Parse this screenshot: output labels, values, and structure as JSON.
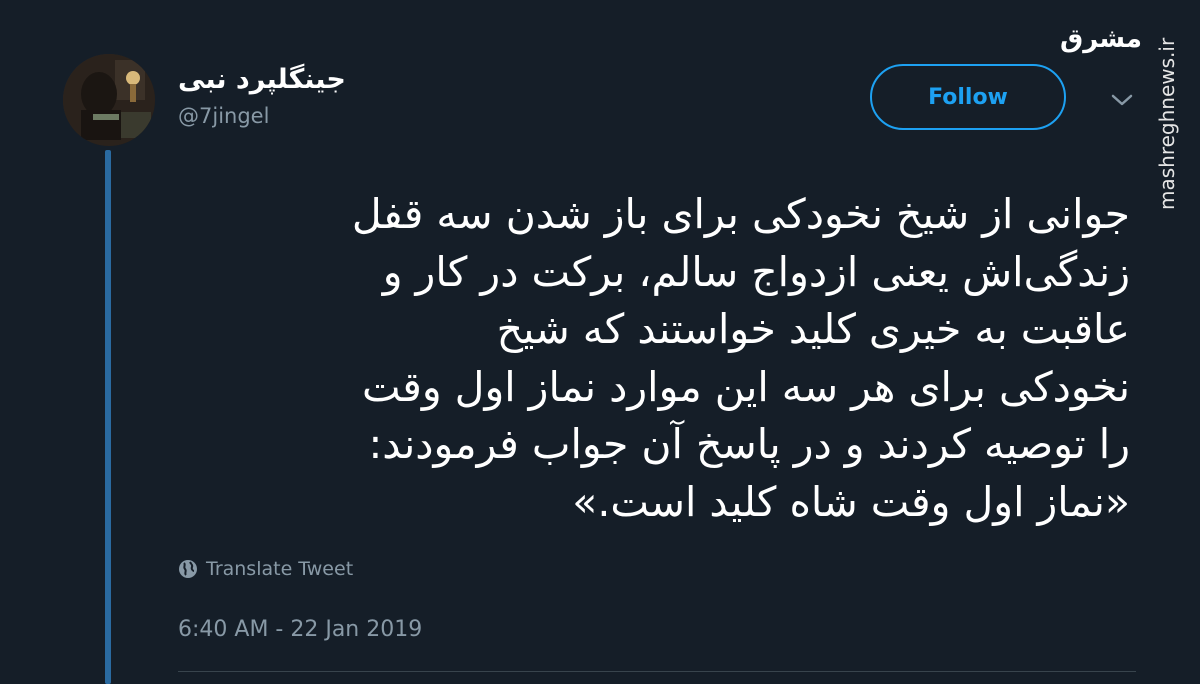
{
  "tweet": {
    "display_name": "جینگلپرد نبی",
    "handle": "@7jingel",
    "follow_label": "Follow",
    "text_lines": [
      "جوانی از شیخ نخودکی برای باز شدن سه قفل",
      "زندگی‌اش یعنی ازدواج سالم، برکت در کار و",
      "عاقبت به خیری کلید خواستند که شیخ",
      "نخودکی برای هر سه این موارد نماز اول وقت",
      "را توصیه کردند و در پاسخ آن جواب فرمودند:",
      "«نماز اول وقت شاه کلید است.»"
    ],
    "translate_label": "Translate Tweet",
    "timestamp": "6:40 AM - 22 Jan 2019"
  },
  "watermark": {
    "logo_text": "مشرق",
    "url": "mashreghnews.ir"
  },
  "icons": {
    "globe": "globe-icon",
    "chevron": "chevron-down-icon"
  },
  "colors": {
    "background": "#151e28",
    "accent": "#1da1f2",
    "secondary_text": "#8899a6",
    "thread_line": "#2a6aa0"
  }
}
